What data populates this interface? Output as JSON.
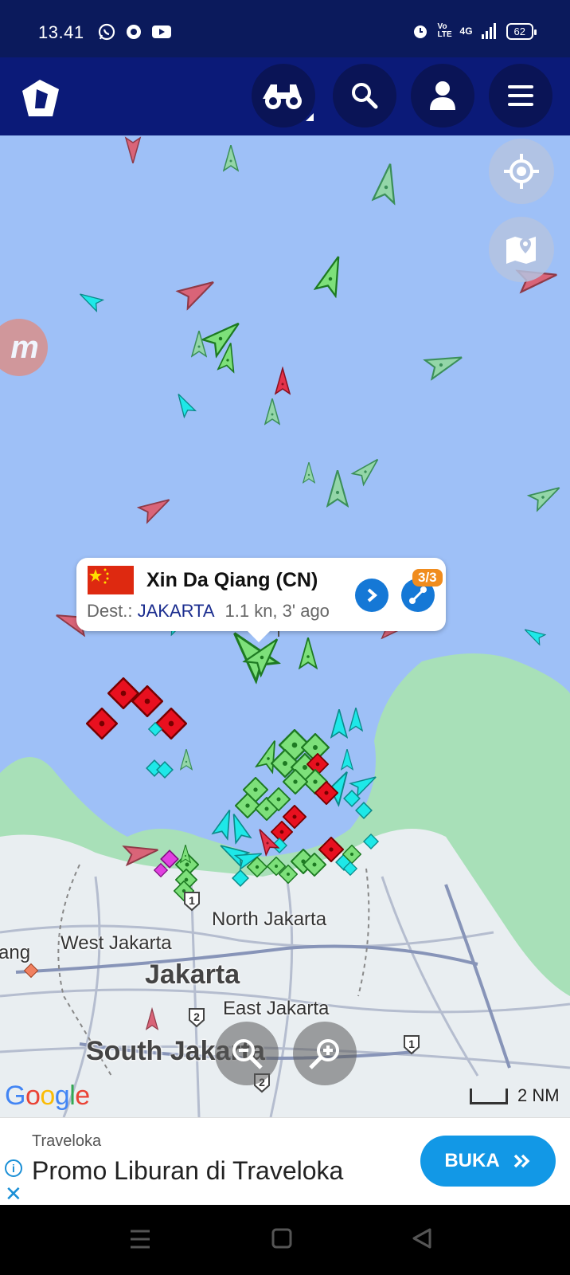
{
  "status_bar": {
    "time": "13.41",
    "network": "4G",
    "volte": "Vo LTE",
    "battery": "62"
  },
  "header": {
    "icons": [
      "marinetraffic-logo-icon",
      "binoculars-icon",
      "search-icon",
      "user-icon",
      "menu-icon"
    ]
  },
  "map": {
    "places": {
      "north_jakarta": "North Jakarta",
      "west_jakarta": "West Jakarta",
      "jakarta": "Jakarta",
      "east_jakarta": "East Jakarta",
      "south_jakarta": "South Jakarta",
      "tangerang_partial": "ang"
    },
    "road_shields": [
      "1",
      "2",
      "2",
      "1"
    ],
    "google": "Google",
    "scale": "2 NM",
    "colors": {
      "water": "#9ec0f7",
      "cargo": "#7de07a",
      "tanker": "#e5334a",
      "passenger": "#1ee8e8",
      "pleasure": "#e040e0"
    }
  },
  "popup": {
    "vessel_name": "Xin Da Qiang (CN)",
    "dest_label": "Dest.:",
    "destination": "JAKARTA",
    "speed_time": "1.1 kn, 3' ago",
    "badge": "3/3",
    "flag_color": "#de2910"
  },
  "ad": {
    "brand": "Traveloka",
    "title": "Promo Liburan di Traveloka",
    "button": "BUKA",
    "accent": "#1298e6"
  }
}
